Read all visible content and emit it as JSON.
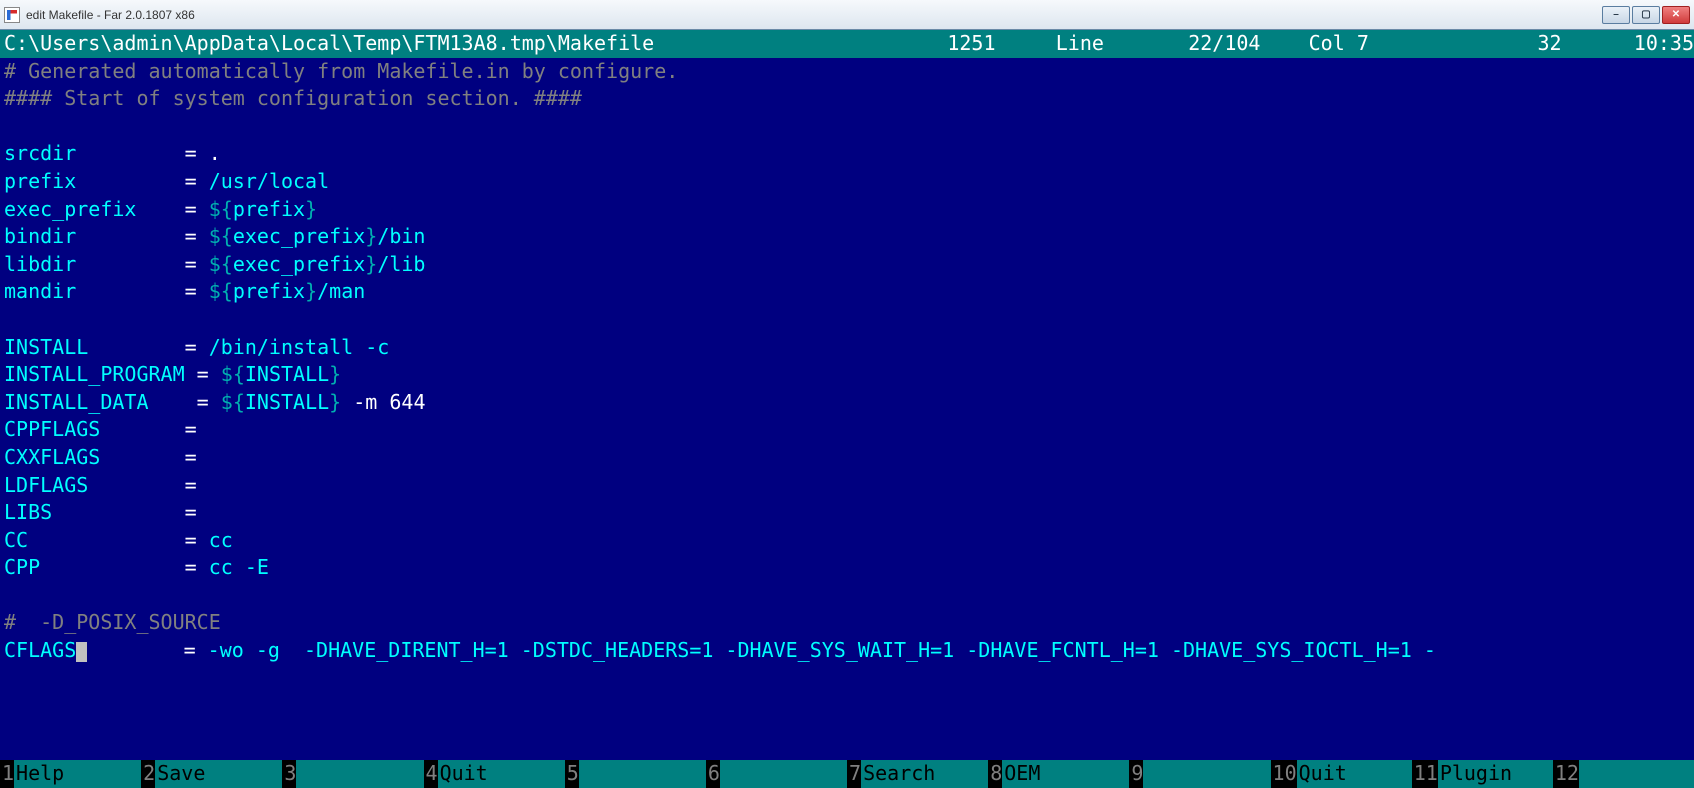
{
  "window": {
    "title": "edit Makefile - Far 2.0.1807 x86"
  },
  "status": {
    "path": "C:\\Users\\admin\\AppData\\Local\\Temp\\FTM13A8.tmp\\Makefile",
    "codepage": "1251",
    "line_label": "Line",
    "line_current": "22",
    "line_total": "104",
    "col_label": "Col",
    "col": "7",
    "char_code": "32",
    "time": "10:35"
  },
  "content": {
    "l1": "# Generated automatically from Makefile.in by configure.",
    "l2": "#### Start of system configuration section. ####",
    "l3": "",
    "srcdir": {
      "k": "srcdir",
      "eq": "= ",
      "v": "."
    },
    "prefix": {
      "k": "prefix",
      "eq": "= ",
      "v1": "/usr/",
      "v2": "local"
    },
    "exec_prefix": {
      "k": "exec_prefix",
      "eq": "= ",
      "d": "$",
      "b1": "{",
      "i": "prefix",
      "b2": "}"
    },
    "bindir": {
      "k": "bindir",
      "eq": "= ",
      "d": "$",
      "b1": "{",
      "i": "exec_prefix",
      "b2": "}",
      "tail": "/bin"
    },
    "libdir": {
      "k": "libdir",
      "eq": "= ",
      "d": "$",
      "b1": "{",
      "i": "exec_prefix",
      "b2": "}",
      "tail": "/lib"
    },
    "mandir": {
      "k": "mandir",
      "eq": "= ",
      "d": "$",
      "b1": "{",
      "i": "prefix",
      "b2": "}",
      "tail": "/man"
    },
    "INSTALL": {
      "k": "INSTALL",
      "eq": "= ",
      "v": "/bin/install -c"
    },
    "INSTALL_PROGRAM": {
      "k": "INSTALL_PROGRAM",
      "eq": "= ",
      "d": "$",
      "b1": "{",
      "i": "INSTALL",
      "b2": "}"
    },
    "INSTALL_DATA": {
      "k": "INSTALL_DATA",
      "eq": "= ",
      "d": "$",
      "b1": "{",
      "i": "INSTALL",
      "b2": "}",
      "tail": " -m 644"
    },
    "CPPFLAGS": {
      "k": "CPPFLAGS",
      "eq": "="
    },
    "CXXFLAGS": {
      "k": "CXXFLAGS",
      "eq": "="
    },
    "LDFLAGS": {
      "k": "LDFLAGS",
      "eq": "="
    },
    "LIBS": {
      "k": "LIBS",
      "eq": "="
    },
    "CC": {
      "k": "CC",
      "eq": "= ",
      "v": "cc"
    },
    "CPP": {
      "k": "CPP",
      "eq": "= ",
      "v": "cc -E"
    },
    "posix": "#  -D_POSIX_SOURCE",
    "CFLAGS": {
      "k": "CFLAGS",
      "eq": "= ",
      "v": "-wo -g  -DHAVE_DIRENT_H=1 -DSTDC_HEADERS=1 -DHAVE_SYS_WAIT_H=1 -DHAVE_FCNTL_H=1 -DHAVE_SYS_IOCTL_H=1 -"
    }
  },
  "fkeys": [
    {
      "n": "1",
      "l": "Help"
    },
    {
      "n": "2",
      "l": "Save"
    },
    {
      "n": "3",
      "l": ""
    },
    {
      "n": "4",
      "l": "Quit"
    },
    {
      "n": "5",
      "l": ""
    },
    {
      "n": "6",
      "l": ""
    },
    {
      "n": "7",
      "l": "Search"
    },
    {
      "n": "8",
      "l": "OEM"
    },
    {
      "n": "9",
      "l": ""
    },
    {
      "n": "10",
      "l": "Quit"
    },
    {
      "n": "11",
      "l": "Plugin"
    },
    {
      "n": "12",
      "l": ""
    }
  ]
}
